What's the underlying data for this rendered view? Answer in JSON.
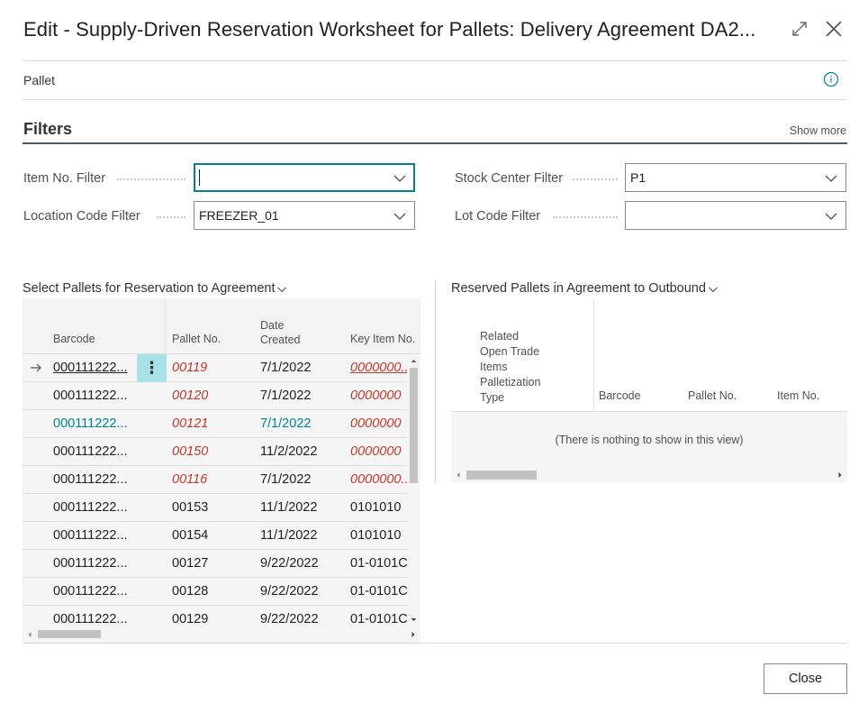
{
  "dialog": {
    "title": "Edit - Supply-Driven Reservation Worksheet for Pallets: Delivery Agreement DA2...",
    "expand_icon": "expand-icon",
    "close_icon": "close-icon"
  },
  "header": {
    "label": "Pallet",
    "info_icon": "info-icon"
  },
  "filters": {
    "title": "Filters",
    "show_more": "Show more",
    "fields": [
      {
        "label": "Item No. Filter",
        "value": ""
      },
      {
        "label": "Stock Center Filter",
        "value": "P1"
      },
      {
        "label": "Location Code Filter",
        "value": "FREEZER_01"
      },
      {
        "label": "Lot Code Filter",
        "value": ""
      }
    ]
  },
  "left_part": {
    "title": "Select Pallets for Reservation to Agreement",
    "columns": {
      "barcode": "Barcode",
      "pallet_no": "Pallet No.",
      "date_line1": "Date",
      "date_line2": "Created",
      "key_item": "Key Item No."
    },
    "rows": [
      {
        "barcode": "000111222...",
        "pallet_no": "00119",
        "date": "7/1/2022",
        "key_item": "0000000..."
      },
      {
        "barcode": "000111222...",
        "pallet_no": "00120",
        "date": "7/1/2022",
        "key_item": "0000000"
      },
      {
        "barcode": "000111222...",
        "pallet_no": "00121",
        "date": "7/1/2022",
        "key_item": "0000000"
      },
      {
        "barcode": "000111222...",
        "pallet_no": "00150",
        "date": "11/2/2022",
        "key_item": "0000000"
      },
      {
        "barcode": "000111222...",
        "pallet_no": "00116",
        "date": "7/1/2022",
        "key_item": "0000000..."
      },
      {
        "barcode": "000111222...",
        "pallet_no": "00153",
        "date": "11/1/2022",
        "key_item": "0101010"
      },
      {
        "barcode": "000111222...",
        "pallet_no": "00154",
        "date": "11/1/2022",
        "key_item": "0101010"
      },
      {
        "barcode": "000111222...",
        "pallet_no": "00127",
        "date": "9/22/2022",
        "key_item": "01-0101C"
      },
      {
        "barcode": "000111222...",
        "pallet_no": "00128",
        "date": "9/22/2022",
        "key_item": "01-0101C"
      },
      {
        "barcode": "000111222...",
        "pallet_no": "00129",
        "date": "9/22/2022",
        "key_item": "01-0101C"
      }
    ]
  },
  "right_part": {
    "title": "Reserved Pallets in Agreement to Outbound",
    "columns": {
      "related_1": "Related",
      "related_2": "Open Trade",
      "related_3": "Items",
      "related_4": "Palletization",
      "related_5": "Type",
      "barcode": "Barcode",
      "pallet_no": "Pallet No.",
      "item_no": "Item No."
    },
    "empty_text": "(There is nothing to show in this view)"
  },
  "footer": {
    "close_label": "Close"
  }
}
